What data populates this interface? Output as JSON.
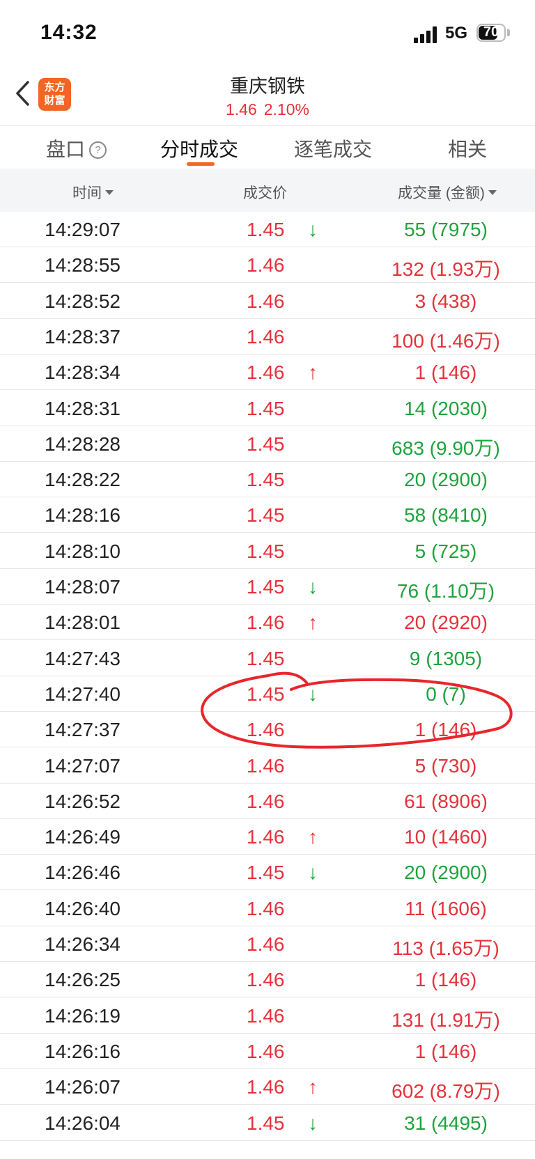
{
  "status_bar": {
    "time": "14:32",
    "network": "5G",
    "battery": "70"
  },
  "header": {
    "stock_name": "重庆钢铁",
    "price": "1.46",
    "change_pct": "2.10%",
    "logo_line1": "东方",
    "logo_line2": "财富"
  },
  "tabs": [
    {
      "label": "盘口",
      "active": false
    },
    {
      "label": "分时成交",
      "active": true
    },
    {
      "label": "逐笔成交",
      "active": false
    },
    {
      "label": "相关",
      "active": false
    }
  ],
  "columns": {
    "time": "时间",
    "price": "成交价",
    "volume": "成交量 (金额)"
  },
  "colors": {
    "up": "#e5323a",
    "down": "#1fa33d",
    "accent": "#f26522",
    "annotation": "#e8262b"
  },
  "trades": [
    {
      "time": "14:29:07",
      "price": "1.45",
      "price_color": "red",
      "arrow": "down",
      "volume": "55 (7975)",
      "volume_color": "green"
    },
    {
      "time": "14:28:55",
      "price": "1.46",
      "price_color": "red",
      "arrow": "",
      "volume": "132 (1.93万)",
      "volume_color": "red"
    },
    {
      "time": "14:28:52",
      "price": "1.46",
      "price_color": "red",
      "arrow": "",
      "volume": "3 (438)",
      "volume_color": "red"
    },
    {
      "time": "14:28:37",
      "price": "1.46",
      "price_color": "red",
      "arrow": "",
      "volume": "100 (1.46万)",
      "volume_color": "red"
    },
    {
      "time": "14:28:34",
      "price": "1.46",
      "price_color": "red",
      "arrow": "up",
      "volume": "1 (146)",
      "volume_color": "red"
    },
    {
      "time": "14:28:31",
      "price": "1.45",
      "price_color": "red",
      "arrow": "",
      "volume": "14 (2030)",
      "volume_color": "green"
    },
    {
      "time": "14:28:28",
      "price": "1.45",
      "price_color": "red",
      "arrow": "",
      "volume": "683 (9.90万)",
      "volume_color": "green"
    },
    {
      "time": "14:28:22",
      "price": "1.45",
      "price_color": "red",
      "arrow": "",
      "volume": "20 (2900)",
      "volume_color": "green"
    },
    {
      "time": "14:28:16",
      "price": "1.45",
      "price_color": "red",
      "arrow": "",
      "volume": "58 (8410)",
      "volume_color": "green"
    },
    {
      "time": "14:28:10",
      "price": "1.45",
      "price_color": "red",
      "arrow": "",
      "volume": "5 (725)",
      "volume_color": "green"
    },
    {
      "time": "14:28:07",
      "price": "1.45",
      "price_color": "red",
      "arrow": "down",
      "volume": "76 (1.10万)",
      "volume_color": "green"
    },
    {
      "time": "14:28:01",
      "price": "1.46",
      "price_color": "red",
      "arrow": "up",
      "volume": "20 (2920)",
      "volume_color": "red"
    },
    {
      "time": "14:27:43",
      "price": "1.45",
      "price_color": "red",
      "arrow": "",
      "volume": "9 (1305)",
      "volume_color": "green"
    },
    {
      "time": "14:27:40",
      "price": "1.45",
      "price_color": "red",
      "arrow": "down",
      "volume": "0 (7)",
      "volume_color": "green"
    },
    {
      "time": "14:27:37",
      "price": "1.46",
      "price_color": "red",
      "arrow": "",
      "volume": "1 (146)",
      "volume_color": "red"
    },
    {
      "time": "14:27:07",
      "price": "1.46",
      "price_color": "red",
      "arrow": "",
      "volume": "5 (730)",
      "volume_color": "red"
    },
    {
      "time": "14:26:52",
      "price": "1.46",
      "price_color": "red",
      "arrow": "",
      "volume": "61 (8906)",
      "volume_color": "red"
    },
    {
      "time": "14:26:49",
      "price": "1.46",
      "price_color": "red",
      "arrow": "up",
      "volume": "10 (1460)",
      "volume_color": "red"
    },
    {
      "time": "14:26:46",
      "price": "1.45",
      "price_color": "red",
      "arrow": "down",
      "volume": "20 (2900)",
      "volume_color": "green"
    },
    {
      "time": "14:26:40",
      "price": "1.46",
      "price_color": "red",
      "arrow": "",
      "volume": "11 (1606)",
      "volume_color": "red"
    },
    {
      "time": "14:26:34",
      "price": "1.46",
      "price_color": "red",
      "arrow": "",
      "volume": "113 (1.65万)",
      "volume_color": "red"
    },
    {
      "time": "14:26:25",
      "price": "1.46",
      "price_color": "red",
      "arrow": "",
      "volume": "1 (146)",
      "volume_color": "red"
    },
    {
      "time": "14:26:19",
      "price": "1.46",
      "price_color": "red",
      "arrow": "",
      "volume": "131 (1.91万)",
      "volume_color": "red"
    },
    {
      "time": "14:26:16",
      "price": "1.46",
      "price_color": "red",
      "arrow": "",
      "volume": "1 (146)",
      "volume_color": "red"
    },
    {
      "time": "14:26:07",
      "price": "1.46",
      "price_color": "red",
      "arrow": "up",
      "volume": "602 (8.79万)",
      "volume_color": "red"
    },
    {
      "time": "14:26:04",
      "price": "1.45",
      "price_color": "red",
      "arrow": "down",
      "volume": "31 (4495)",
      "volume_color": "green"
    }
  ]
}
